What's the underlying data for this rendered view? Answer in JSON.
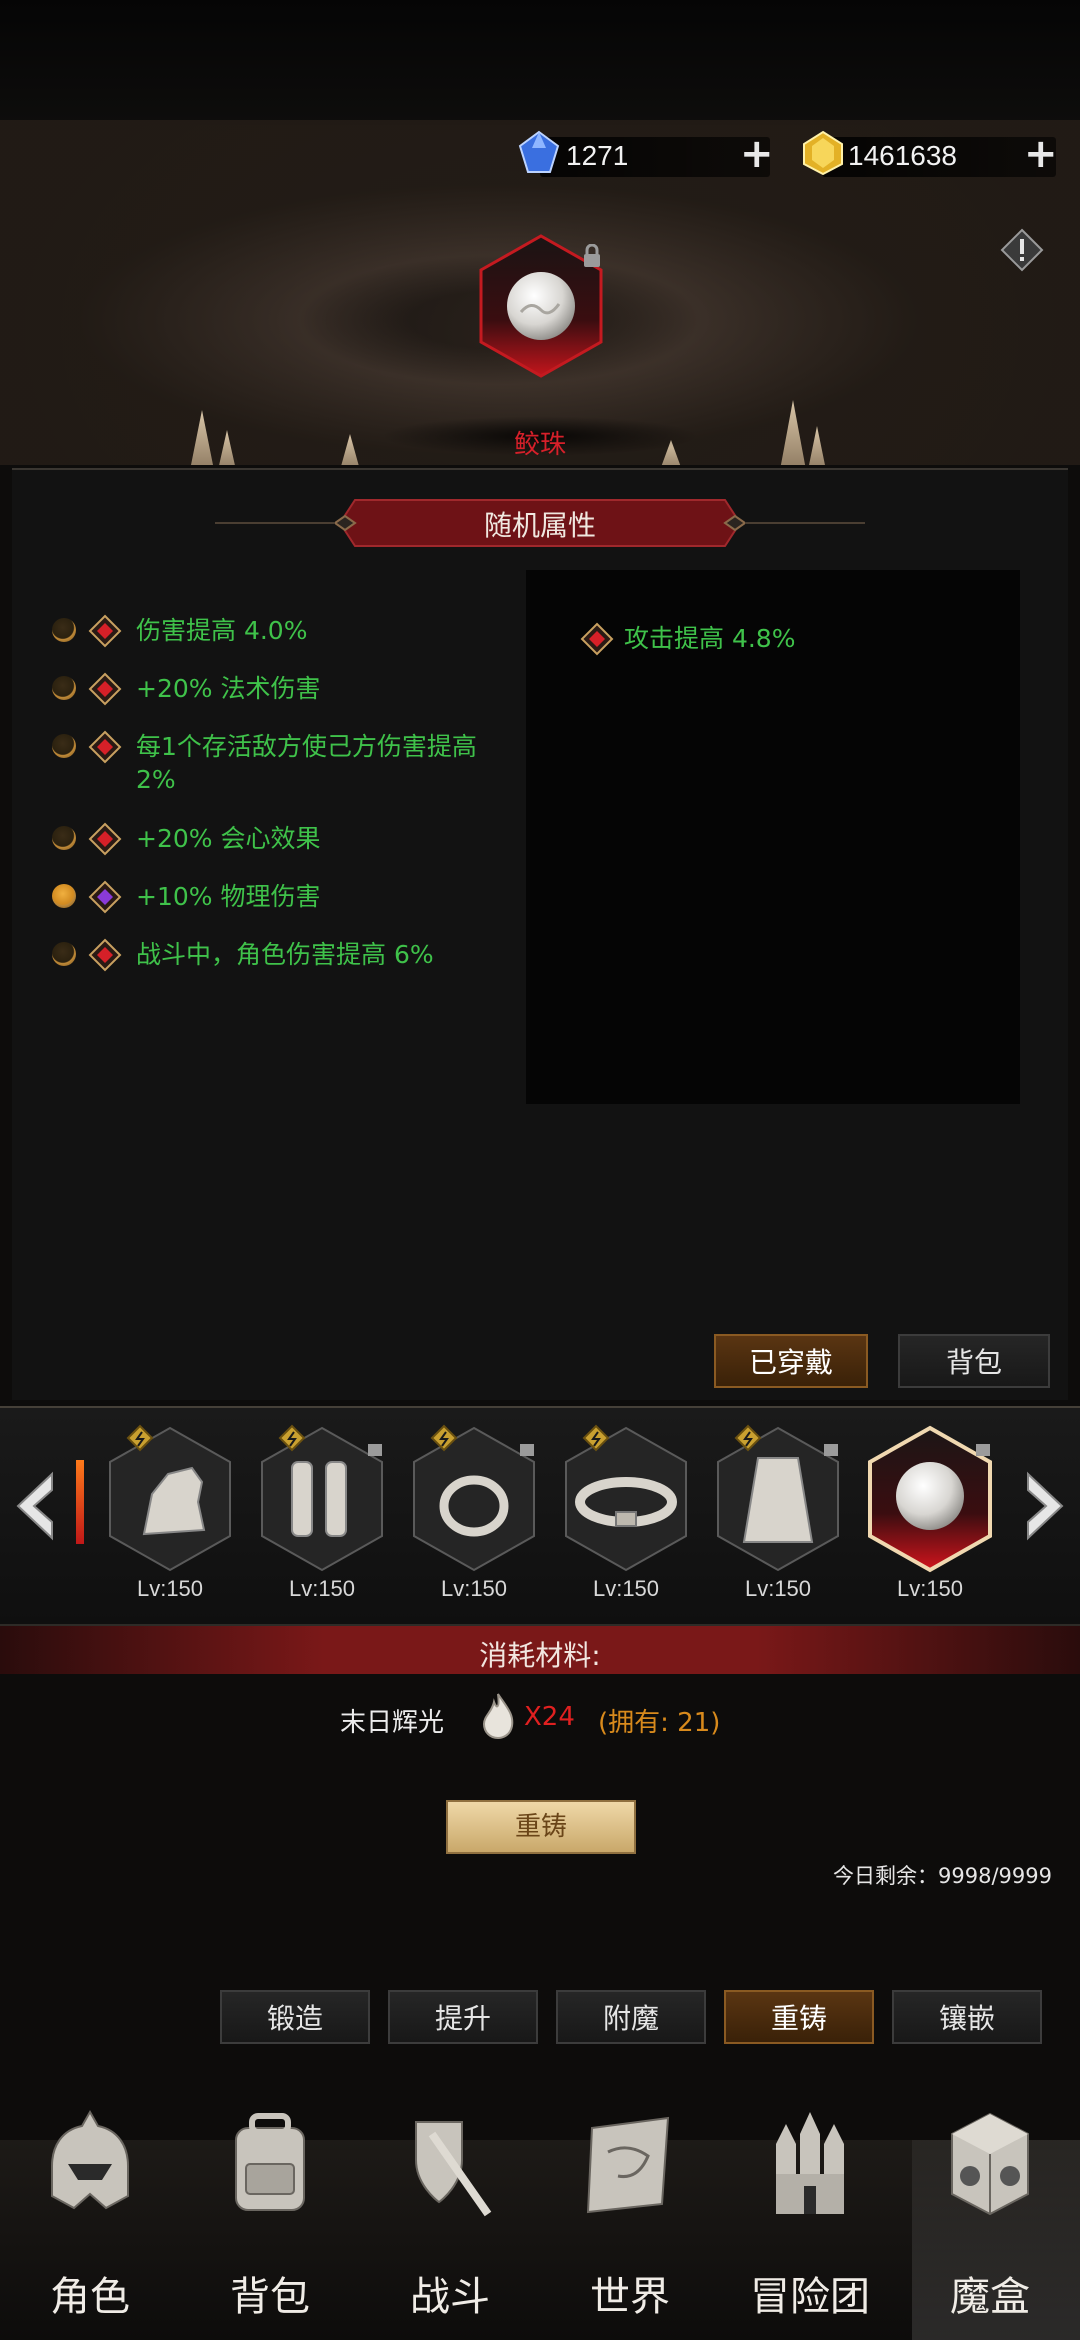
{
  "currency": {
    "gems": "1271",
    "gold": "1461638"
  },
  "item": {
    "name": "鲛珠",
    "slot_level": "Lv:150"
  },
  "panel": {
    "section_title": "随机属性",
    "attributes": [
      {
        "text": "伤害提高 4.0%",
        "selected": false
      },
      {
        "text": "+20% 法术伤害",
        "selected": false
      },
      {
        "text": "每1个存活敌方使己方伤害提高 2%",
        "selected": false
      },
      {
        "text": "+20% 会心效果",
        "selected": false
      },
      {
        "text": "+10% 物理伤害",
        "selected": true
      },
      {
        "text": "战斗中，角色伤害提高 6%",
        "selected": false
      }
    ],
    "current_attribute": "攻击提高 4.8%",
    "equipped_label": "已穿戴",
    "bag_label": "背包"
  },
  "equipment": [
    {
      "icon": "glove-icon",
      "level": "Lv:150"
    },
    {
      "icon": "leg-armor-icon",
      "level": "Lv:150"
    },
    {
      "icon": "ring-icon",
      "level": "Lv:150"
    },
    {
      "icon": "belt-icon",
      "level": "Lv:150"
    },
    {
      "icon": "cloak-icon",
      "level": "Lv:150"
    },
    {
      "icon": "pearl-icon",
      "level": "Lv:150",
      "selected": true
    }
  ],
  "materials": {
    "title": "消耗材料:",
    "name": "末日辉光",
    "cost": "X24",
    "owned": "(拥有: 21)",
    "recast_button": "重铸",
    "remaining": "今日剩余：9998/9999"
  },
  "function_tabs": [
    "锻造",
    "提升",
    "附魔",
    "重铸",
    "镶嵌"
  ],
  "active_tab": "重铸",
  "nav": [
    "角色",
    "背包",
    "战斗",
    "世界",
    "冒险团",
    "魔盒"
  ],
  "colors": {
    "attr_green": "#3fc24a",
    "item_red": "#d6202a",
    "cost_red": "#e02020",
    "owned_orange": "#d88a1c",
    "active_tab": "#5a3512"
  }
}
